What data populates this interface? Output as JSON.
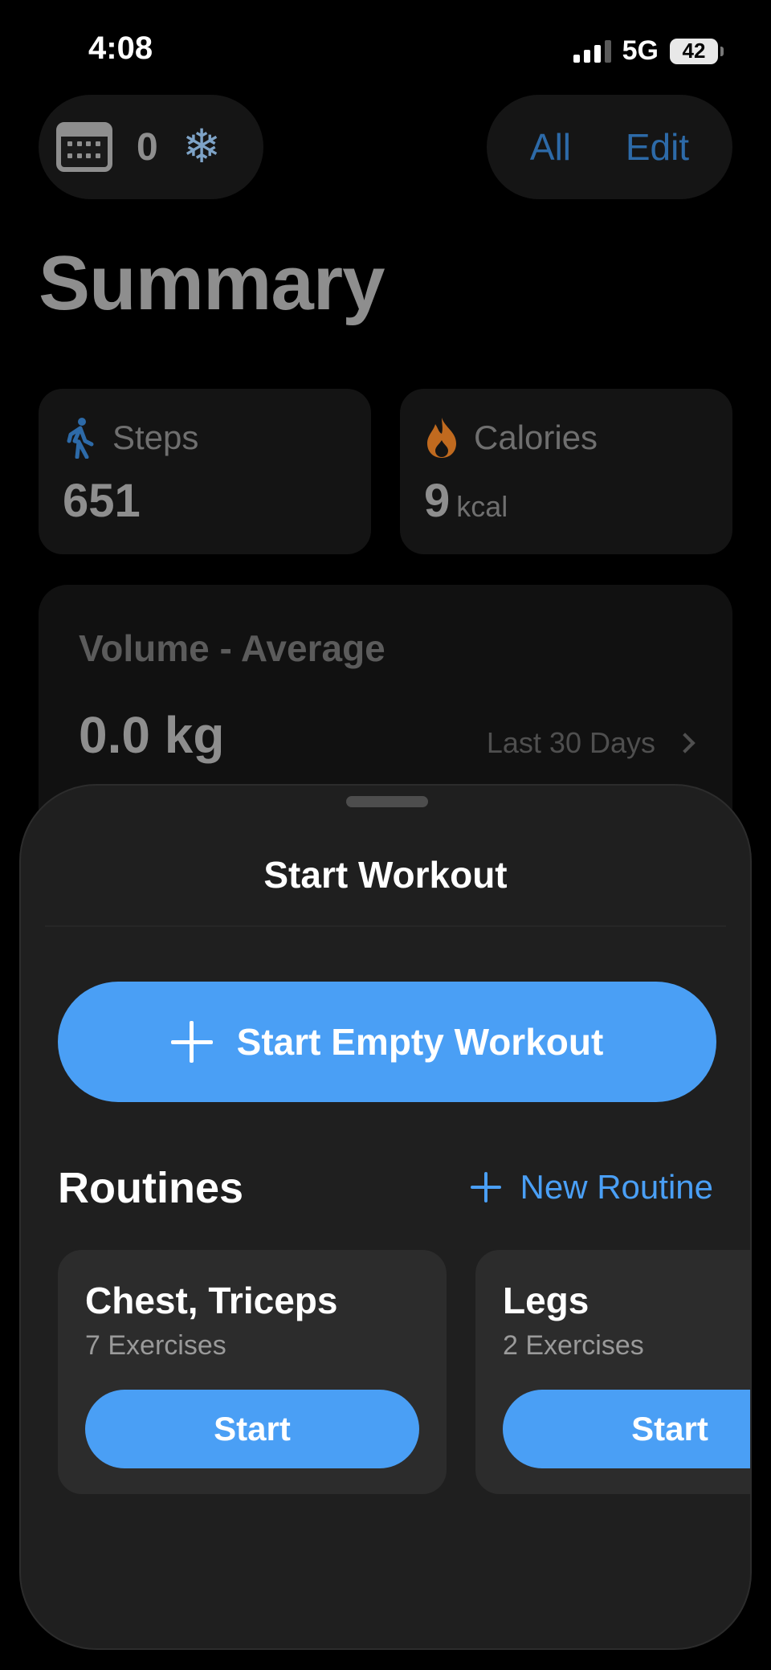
{
  "status": {
    "time": "4:08",
    "network": "5G",
    "battery": "42"
  },
  "header": {
    "streak_count": "0",
    "all_label": "All",
    "edit_label": "Edit"
  },
  "page": {
    "title": "Summary"
  },
  "stats": {
    "steps": {
      "label": "Steps",
      "value": "651"
    },
    "calories": {
      "label": "Calories",
      "value": "9",
      "unit": "kcal"
    }
  },
  "volume": {
    "title": "Volume - Average",
    "value": "0.0 kg",
    "range": "Last 30 Days"
  },
  "sheet": {
    "title": "Start Workout",
    "start_empty_label": "Start Empty Workout",
    "routines_title": "Routines",
    "new_routine_label": "New Routine",
    "routines": [
      {
        "name": "Chest, Triceps",
        "count": "7 Exercises",
        "start_label": "Start"
      },
      {
        "name": "Legs",
        "count": "2 Exercises",
        "start_label": "Start"
      }
    ]
  },
  "colors": {
    "accent": "#4a9ff5",
    "background": "#000000",
    "sheet": "#1f1f1f",
    "card": "#2c2c2c",
    "calorie_icon": "#c06a1f"
  },
  "icons": [
    "calendar-icon",
    "snowflake-icon",
    "walking-icon",
    "flame-icon",
    "chevron-right-icon",
    "plus-icon"
  ]
}
